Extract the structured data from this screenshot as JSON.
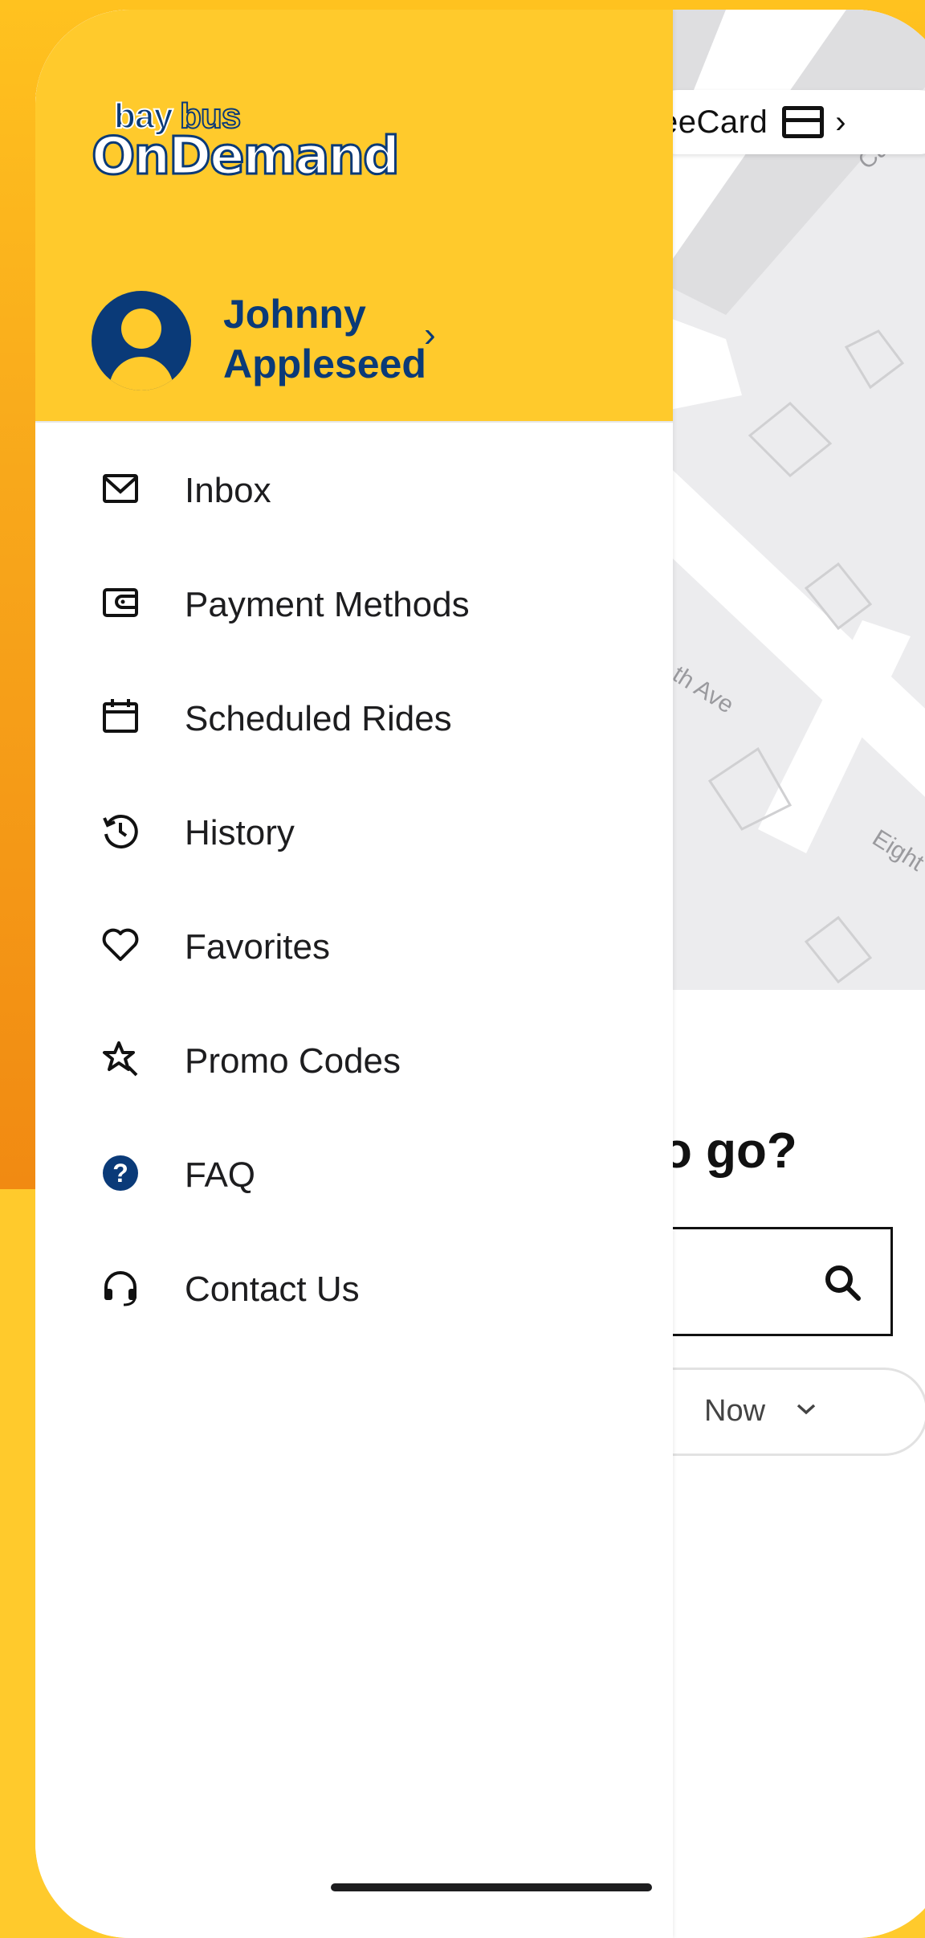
{
  "background_app": {
    "card_label": "eeCard",
    "street_names": [
      "Carne",
      "th Ave",
      "Eight"
    ],
    "sheet_title": "o go?",
    "time_option": "Now"
  },
  "drawer": {
    "logo": {
      "top": "baybus",
      "top_a": "bay",
      "top_b": "bus",
      "bottom": "OnDemand"
    },
    "user": {
      "first_name": "Johnny",
      "last_name": "Appleseed"
    },
    "menu": [
      {
        "label": "Inbox",
        "icon": "envelope-icon"
      },
      {
        "label": "Payment Methods",
        "icon": "wallet-icon"
      },
      {
        "label": "Scheduled Rides",
        "icon": "calendar-icon"
      },
      {
        "label": "History",
        "icon": "history-icon"
      },
      {
        "label": "Favorites",
        "icon": "heart-icon"
      },
      {
        "label": "Promo Codes",
        "icon": "promo-icon"
      },
      {
        "label": "FAQ",
        "icon": "question-icon"
      },
      {
        "label": "Contact Us",
        "icon": "headset-icon"
      }
    ]
  },
  "colors": {
    "brand_yellow": "#ffca2c",
    "brand_navy": "#0a3a78",
    "brand_orange": "#f18a12"
  }
}
